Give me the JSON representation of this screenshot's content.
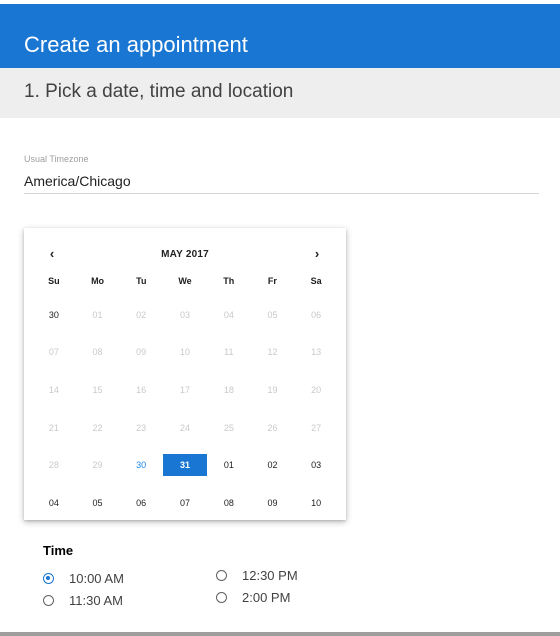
{
  "header": {
    "title": "Create an appointment"
  },
  "step": {
    "title": "1. Pick a date, time and location"
  },
  "timezone": {
    "label": "Usual Timezone",
    "value": "America/Chicago"
  },
  "calendar": {
    "month_label": "MAY 2017",
    "prev_icon": "chevron-left-icon",
    "next_icon": "chevron-right-icon",
    "prev_glyph": "‹",
    "next_glyph": "›",
    "weekdays": [
      "Su",
      "Mo",
      "Tu",
      "We",
      "Th",
      "Fr",
      "Sa"
    ],
    "days": [
      {
        "label": "30",
        "state": "active"
      },
      {
        "label": "01",
        "state": "disabled"
      },
      {
        "label": "02",
        "state": "disabled"
      },
      {
        "label": "03",
        "state": "disabled"
      },
      {
        "label": "04",
        "state": "disabled"
      },
      {
        "label": "05",
        "state": "disabled"
      },
      {
        "label": "06",
        "state": "disabled"
      },
      {
        "label": "07",
        "state": "disabled"
      },
      {
        "label": "08",
        "state": "disabled"
      },
      {
        "label": "09",
        "state": "disabled"
      },
      {
        "label": "10",
        "state": "disabled"
      },
      {
        "label": "11",
        "state": "disabled"
      },
      {
        "label": "12",
        "state": "disabled"
      },
      {
        "label": "13",
        "state": "disabled"
      },
      {
        "label": "14",
        "state": "disabled"
      },
      {
        "label": "15",
        "state": "disabled"
      },
      {
        "label": "16",
        "state": "disabled"
      },
      {
        "label": "17",
        "state": "disabled"
      },
      {
        "label": "18",
        "state": "disabled"
      },
      {
        "label": "19",
        "state": "disabled"
      },
      {
        "label": "20",
        "state": "disabled"
      },
      {
        "label": "21",
        "state": "disabled"
      },
      {
        "label": "22",
        "state": "disabled"
      },
      {
        "label": "23",
        "state": "disabled"
      },
      {
        "label": "24",
        "state": "disabled"
      },
      {
        "label": "25",
        "state": "disabled"
      },
      {
        "label": "26",
        "state": "disabled"
      },
      {
        "label": "27",
        "state": "disabled"
      },
      {
        "label": "28",
        "state": "disabled"
      },
      {
        "label": "29",
        "state": "disabled"
      },
      {
        "label": "30",
        "state": "today"
      },
      {
        "label": "31",
        "state": "selected"
      },
      {
        "label": "01",
        "state": "active"
      },
      {
        "label": "02",
        "state": "active"
      },
      {
        "label": "03",
        "state": "active"
      },
      {
        "label": "04",
        "state": "active"
      },
      {
        "label": "05",
        "state": "active"
      },
      {
        "label": "06",
        "state": "active"
      },
      {
        "label": "07",
        "state": "active"
      },
      {
        "label": "08",
        "state": "active"
      },
      {
        "label": "09",
        "state": "active"
      },
      {
        "label": "10",
        "state": "active"
      }
    ]
  },
  "time": {
    "heading": "Time",
    "options": [
      {
        "label": "10:00 AM",
        "checked": true
      },
      {
        "label": "11:30 AM",
        "checked": false
      },
      {
        "label": "12:30 PM",
        "checked": false
      },
      {
        "label": "2:00 PM",
        "checked": false
      }
    ]
  },
  "colors": {
    "primary": "#1976d2",
    "today": "#1e88e5",
    "step_bar": "#eeeeee",
    "disabled_day": "#c9c9c9"
  }
}
